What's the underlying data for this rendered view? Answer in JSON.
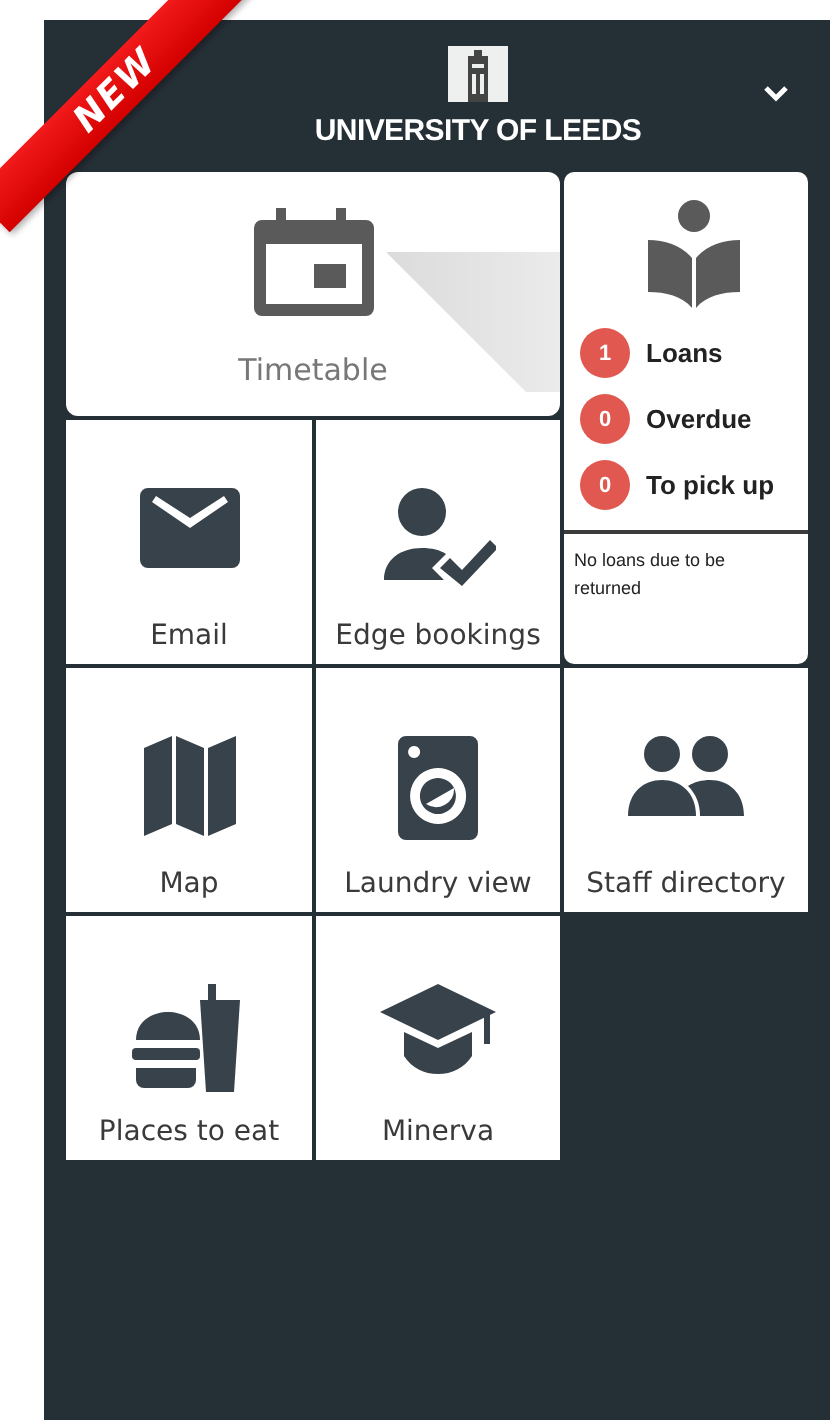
{
  "badge": "NEW",
  "header": {
    "title": "UNIVERSITY OF LEEDS"
  },
  "tiles": [
    {
      "kind": "wide",
      "label": "Timetable"
    },
    {
      "kind": "library",
      "counters": [
        {
          "count": "1",
          "label": "Loans"
        },
        {
          "count": "0",
          "label": "Overdue"
        },
        {
          "count": "0",
          "label": "To pick up"
        }
      ],
      "note": "No loans due to be returned"
    },
    {
      "kind": "tile",
      "label": "Email"
    },
    {
      "kind": "tile",
      "label": "Edge bookings"
    },
    {
      "kind": "tile",
      "label": "Map"
    },
    {
      "kind": "tile",
      "label": "Laundry view"
    },
    {
      "kind": "tile",
      "label": "Staff directory"
    },
    {
      "kind": "tile",
      "label": "Places to eat"
    },
    {
      "kind": "tile",
      "label": "Minerva"
    }
  ]
}
